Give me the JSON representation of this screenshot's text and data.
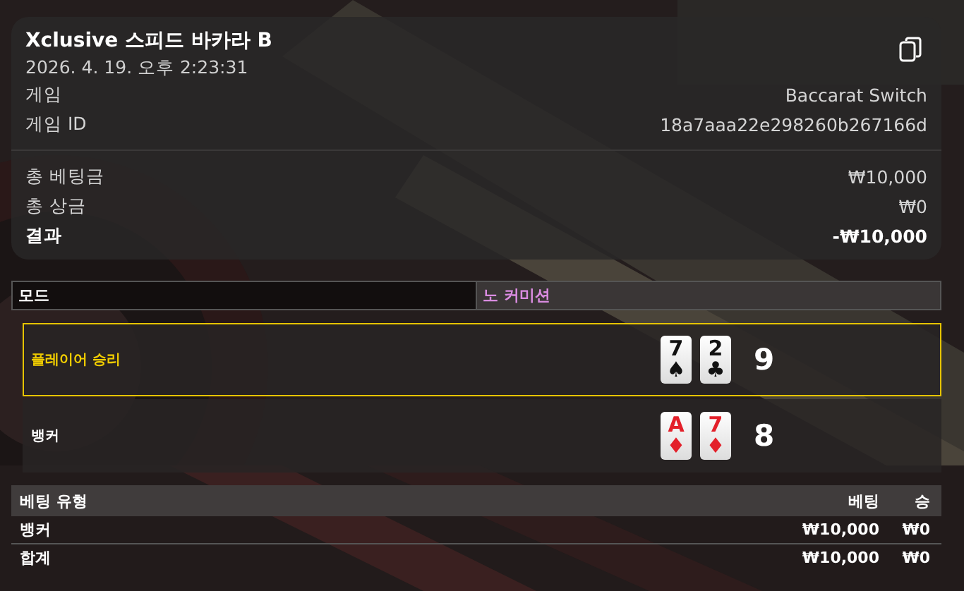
{
  "summary": {
    "title": "Xclusive 스피드 바카라 B",
    "datetime": "2026. 4. 19. 오후 2:23:31",
    "info": [
      {
        "label": "게임",
        "value": "Baccarat Switch"
      },
      {
        "label": "게임 ID",
        "value": "18a7aaa22e298260b267166d"
      }
    ],
    "totals": [
      {
        "label": "총 베팅금",
        "value": "₩10,000",
        "kind": "normal"
      },
      {
        "label": "총 상금",
        "value": "₩0",
        "kind": "normal"
      },
      {
        "label": "결과",
        "value": "-₩10,000",
        "kind": "total"
      }
    ]
  },
  "mode": {
    "label": "모드",
    "value": "노 커미션"
  },
  "hands": [
    {
      "label": "플레이어 승리",
      "winner": true,
      "score": "9",
      "cards": [
        {
          "rank": "7",
          "suit": "♠",
          "color": "#111111"
        },
        {
          "rank": "2",
          "suit": "♣",
          "color": "#111111"
        }
      ]
    },
    {
      "label": "뱅커",
      "winner": false,
      "score": "8",
      "cards": [
        {
          "rank": "A",
          "suit": "♦",
          "color": "#e3202a"
        },
        {
          "rank": "7",
          "suit": "♦",
          "color": "#e3202a"
        }
      ]
    }
  ],
  "bets": {
    "columns": [
      "베팅 유형",
      "베팅",
      "승"
    ],
    "rows": [
      [
        "뱅커",
        "₩10,000",
        "₩0"
      ],
      [
        "합계",
        "₩10,000",
        "₩0"
      ]
    ]
  }
}
